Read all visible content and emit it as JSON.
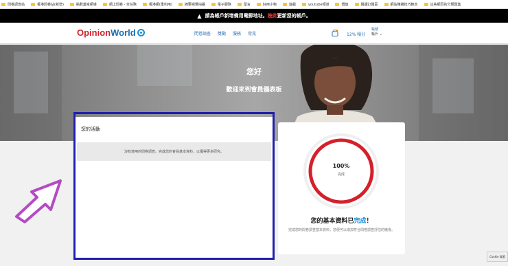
{
  "bookmarks": [
    "問卷調查站",
    "香港問卷站(新增)",
    "點數蓋章網導",
    "網上問卷 - 全任務",
    "香港網(重利用)",
    "摘要視覺拍攝",
    "電子服務",
    "留言",
    "好用小物",
    "遊戲",
    "youtube頻道",
    "價值",
    "閱讀訂閱區",
    "網站賺錢技巧範本",
    "這些網頁的分類匯集"
  ],
  "alert": {
    "text_before": "請為帳戶新增備用電郵地址。",
    "emphasis": "按此",
    "text_after": "更新您的帳戶。"
  },
  "nav": {
    "logo_opinion": "Opinion",
    "logo_world": "World",
    "menu": [
      "問卷調查",
      "獎勵",
      "服務",
      "常見"
    ],
    "points": "12% 積分",
    "account_label": "帳號",
    "account_name": "帳戶 ⌄"
  },
  "hero": {
    "greeting": "您好",
    "subtitle": "歡迎來到會員儀表板"
  },
  "activity": {
    "title": "您的活動",
    "message": "沒有適用的問卷調查。完成您的會員基本資料，以獲得更多研究。"
  },
  "profile": {
    "percent": "100%",
    "percent_label": "完成",
    "progress": 1.0,
    "title_prefix": "您的基本資料已",
    "title_highlight": "完成",
    "title_suffix": "！",
    "description": "完成您的問卷調查基本資料，您便可以增加符合問卷調查評估的機會。"
  },
  "cookie": {
    "label": "Cookie 政策"
  },
  "colors": {
    "brand_red": "#d5202a",
    "brand_blue": "#1a8ed1",
    "highlight": "#1e1eb0",
    "arrow": "#b44bc4"
  }
}
